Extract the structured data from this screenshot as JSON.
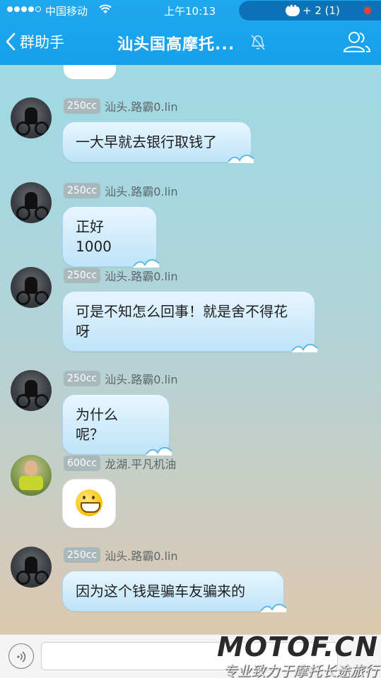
{
  "status_bar": {
    "carrier": "中国移动",
    "time": "上午10:13",
    "notification_count": "+ 2 (1)"
  },
  "nav": {
    "back_label": "群助手",
    "title": "汕头国高摩托..."
  },
  "messages": [
    {
      "badge": "250cc",
      "nick": "汕头.路霸0.lin",
      "text": "一大早就去银行取钱了"
    },
    {
      "badge": "250cc",
      "nick": "汕头.路霸0.lin",
      "text": "正好1000"
    },
    {
      "badge": "250cc",
      "nick": "汕头.路霸0.lin",
      "text": "可是不知怎么回事！就是舍不得花呀"
    },
    {
      "badge": "250cc",
      "nick": "汕头.路霸0.lin",
      "text": "为什么呢？"
    },
    {
      "badge": "600cc",
      "nick": "龙湖.平凡机油",
      "text": "",
      "emoji": "grin-emoji"
    },
    {
      "badge": "250cc",
      "nick": "汕头.路霸0.lin",
      "text": "因为这个钱是骗车友骗来的"
    }
  ],
  "input": {
    "value": ""
  },
  "watermark": {
    "logo": "MOTOF.CN",
    "tagline": "专业致力于摩托长途旅行"
  },
  "colors": {
    "nav_bg": "#1fa8ef",
    "bubble_bg": "#d3ecfb",
    "badge_bg": "#a9b8bb"
  }
}
